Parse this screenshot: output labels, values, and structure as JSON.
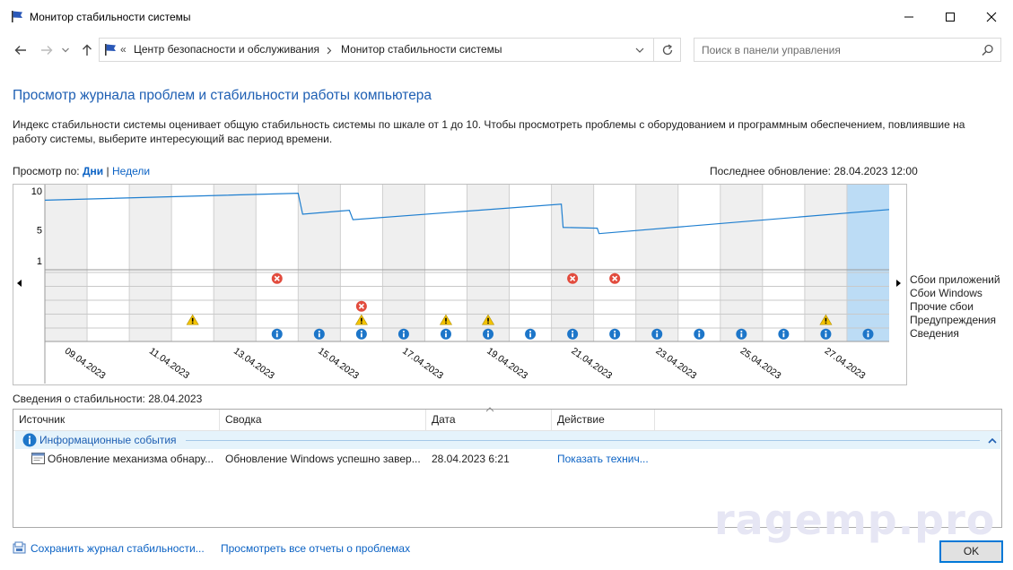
{
  "window": {
    "title": "Монитор стабильности системы"
  },
  "address": {
    "separator_left": "«",
    "crumbs": [
      "Центр безопасности и обслуживания",
      "Монитор стабильности системы"
    ],
    "search_placeholder": "Поиск в панели управления"
  },
  "header": {
    "title": "Просмотр журнала проблем и стабильности работы компьютера",
    "description": "Индекс стабильности системы оценивает общую стабильность системы по шкале от 1 до 10. Чтобы просмотреть проблемы с оборудованием и программным обеспечением, повлиявшие на работу системы, выберите интересующий вас период времени."
  },
  "view_by": {
    "label": "Просмотр по:",
    "days": "Дни",
    "sep": "|",
    "weeks": "Недели"
  },
  "last_update": "Последнее обновление: 28.04.2023 12:00",
  "chart_data": {
    "type": "line",
    "ylim": [
      1,
      10
    ],
    "y_ticks": [
      "10",
      "5",
      "1"
    ],
    "x_tick_labels": [
      "09.04.2023",
      "11.04.2023",
      "13.04.2023",
      "15.04.2023",
      "17.04.2023",
      "19.04.2023",
      "21.04.2023",
      "23.04.2023",
      "25.04.2023",
      "27.04.2023"
    ],
    "days": 20,
    "selected_day_index": 19,
    "stability_index": [
      8.8,
      9.0,
      9.1,
      9.3,
      9.4,
      9.6,
      6.9,
      7.0,
      6.3,
      6.8,
      7.2,
      7.6,
      7.9,
      4.8,
      4.5,
      5.2,
      6.2,
      6.7,
      7.0,
      7.4,
      7.6
    ],
    "legend": [
      "Сбои приложений",
      "Сбои Windows",
      "Прочие сбои",
      "Предупреждения",
      "Сведения"
    ],
    "events": {
      "app_failures": [
        5,
        12,
        13
      ],
      "windows_failures": [],
      "other_failures": [
        7
      ],
      "warnings": [
        3,
        7,
        9,
        10,
        18
      ],
      "info": [
        5,
        6,
        7,
        8,
        9,
        10,
        11,
        12,
        13,
        14,
        15,
        16,
        17,
        18,
        19
      ]
    }
  },
  "details": {
    "title": "Сведения о стабильности: 28.04.2023",
    "columns": [
      "Источник",
      "Сводка",
      "Дата",
      "Действие"
    ],
    "group_label": "Информационные события",
    "rows": [
      {
        "source": "Обновление механизма обнару...",
        "summary": "Обновление Windows успешно завер...",
        "date": "28.04.2023 6:21",
        "action": "Показать технич..."
      }
    ]
  },
  "footer": {
    "save_link": "Сохранить журнал стабильности...",
    "reports_link": "Просмотреть все отчеты о проблемах",
    "ok": "OK"
  },
  "watermark": "ragemp.pro",
  "colors": {
    "link": "#0b62c4",
    "title": "#1e5fb3",
    "line": "#1f7fd0",
    "selected_col": "#bcdcf5",
    "shaded_col": "#efefef",
    "error": "#e24b3d",
    "warning": "#f3c300",
    "info": "#1d76c9"
  }
}
